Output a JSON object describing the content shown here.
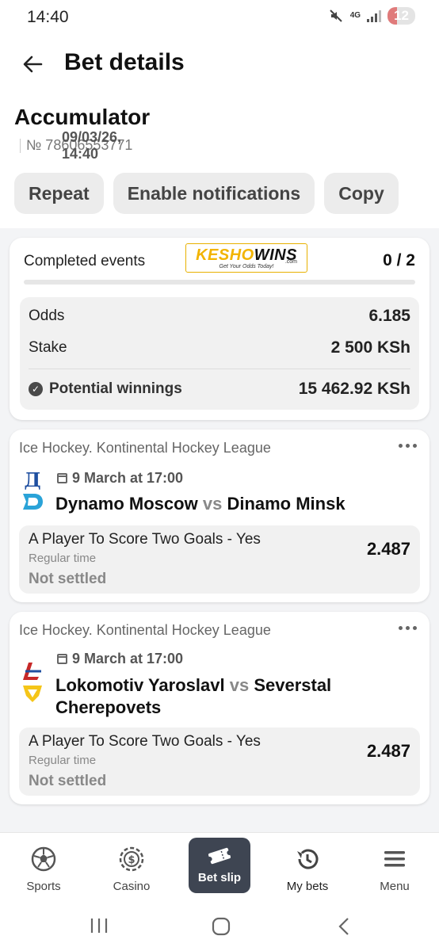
{
  "status_bar": {
    "time": "14:40",
    "network": "4G",
    "battery": "12"
  },
  "header": {
    "title": "Bet details"
  },
  "bet": {
    "type": "Accumulator",
    "date": "09/03/26, 14:40",
    "number": "№ 78606553771"
  },
  "actions": {
    "repeat": "Repeat",
    "notifications": "Enable notifications",
    "copy": "Copy"
  },
  "summary": {
    "completed_label": "Completed events",
    "completed_value": "0 / 2",
    "completed_fraction": 0,
    "logo": {
      "brand_left": "KESHO",
      "brand_right": "WINS",
      "domain": ".com",
      "tagline": "Get Your Odds Today!"
    },
    "odds_label": "Odds",
    "odds_value": "6.185",
    "stake_label": "Stake",
    "stake_value": "2 500 KSh",
    "winnings_label": "Potential winnings",
    "winnings_value": "15 462.92 KSh"
  },
  "events": [
    {
      "league": "Ice Hockey. Kontinental Hockey League",
      "date": "9 March at 17:00",
      "home": "Dynamo Moscow",
      "vs": "vs",
      "away": "Dinamo Minsk",
      "market": "A Player To Score Two Goals - Yes",
      "period": "Regular time",
      "status": "Not settled",
      "odd": "2.487"
    },
    {
      "league": "Ice Hockey. Kontinental Hockey League",
      "date": "9 March at 17:00",
      "home": "Lokomotiv Yaroslavl",
      "vs": "vs",
      "away": "Severstal Cherepovets",
      "market": "A Player To Score Two Goals - Yes",
      "period": "Regular time",
      "status": "Not settled",
      "odd": "2.487"
    }
  ],
  "nav": {
    "sports": "Sports",
    "casino": "Casino",
    "bet_slip": "Bet slip",
    "my_bets": "My bets",
    "menu": "Menu"
  },
  "colors": {
    "accent": "#2e6fd8",
    "active_nav": "#3e4552",
    "logo_gold": "#f2b400"
  }
}
